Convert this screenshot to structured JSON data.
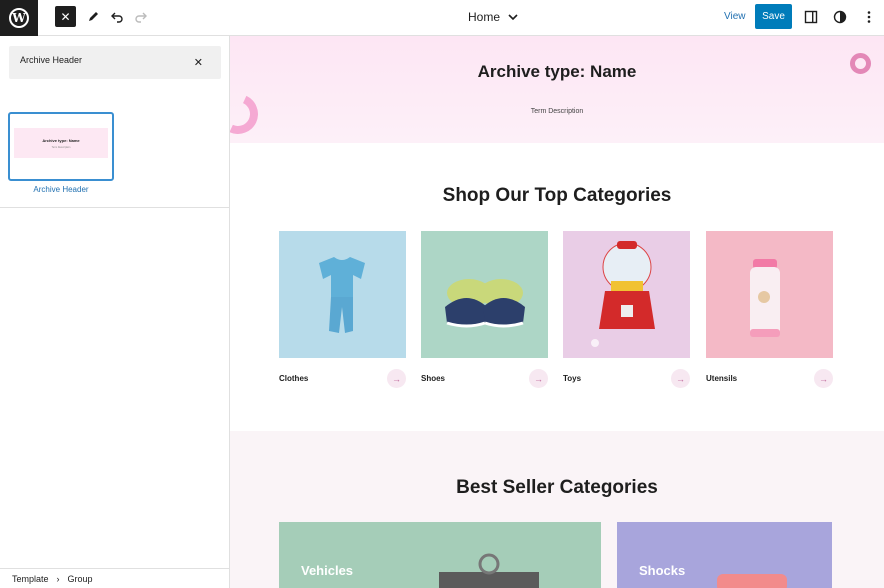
{
  "topbar": {
    "logo": "W",
    "close_icon": "✕",
    "document_title": "Home",
    "view_label": "View",
    "save_label": "Save"
  },
  "sidebar": {
    "search_value": "Archive Header",
    "clear_icon": "✕",
    "pattern": {
      "label": "Archive Header",
      "preview_title": "Archive type: Name",
      "preview_sub": "Term Description"
    },
    "breadcrumb": [
      "Template",
      "Group"
    ],
    "breadcrumb_sep": "›"
  },
  "canvas": {
    "hero": {
      "title": "Archive type: Name",
      "description": "Term Description"
    },
    "top_categories": {
      "title": "Shop Our Top Categories",
      "items": [
        {
          "name": "Clothes",
          "bg": "#b7dbea"
        },
        {
          "name": "Shoes",
          "bg": "#add6c6"
        },
        {
          "name": "Toys",
          "bg": "#e9cde6"
        },
        {
          "name": "Utensils",
          "bg": "#f4b9c6"
        }
      ],
      "arrow": "→"
    },
    "best_seller": {
      "title": "Best Seller Categories",
      "cards": [
        {
          "name": "Vehicles",
          "bg": "#a5cdb8"
        },
        {
          "name": "Shocks",
          "bg": "#a8a5dc"
        }
      ]
    }
  },
  "colors": {
    "accent": "#007cba",
    "link": "#2271b1",
    "hero_bg": "#fde6f4"
  }
}
